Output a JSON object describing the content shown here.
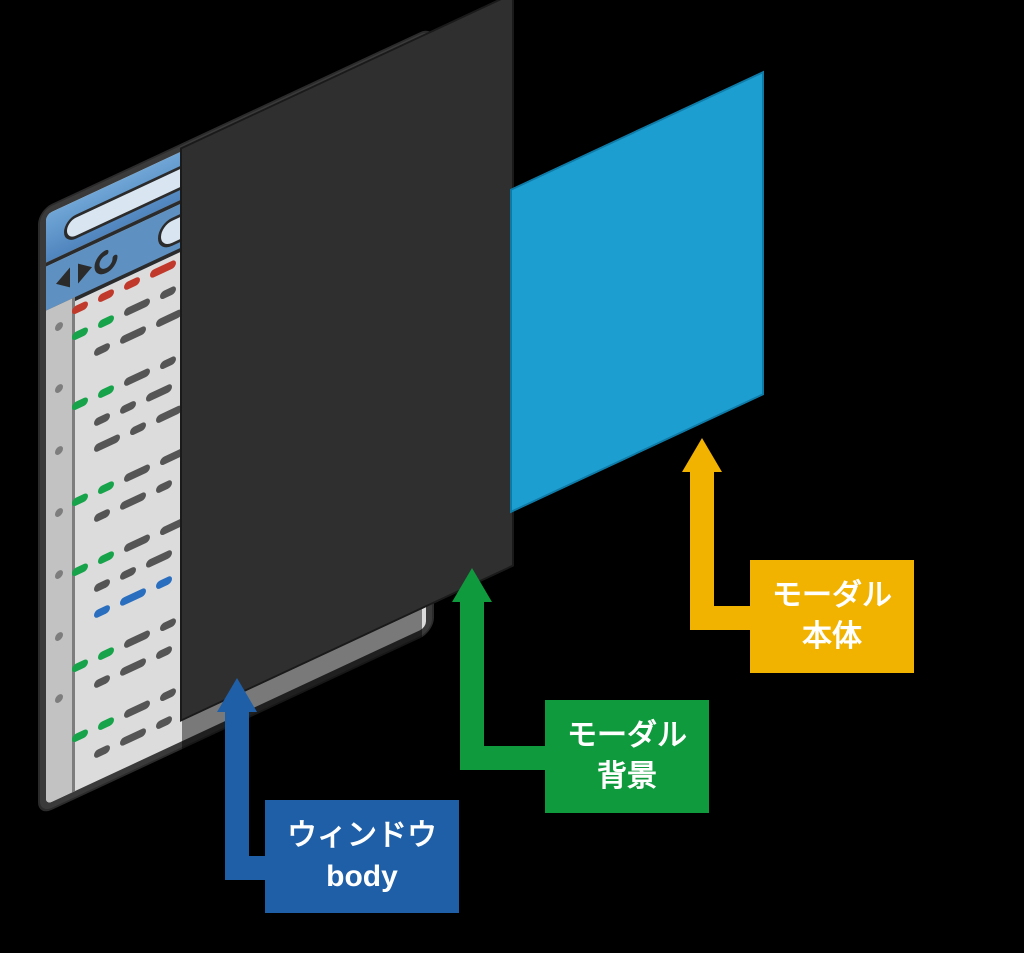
{
  "diagram": {
    "description": "Isometric illustration of three stacked browser layers: the page body, a dark modal backdrop overlay, and a blue modal dialog plane floating in front.",
    "layers": [
      {
        "id": "window-body",
        "label_lines": [
          "ウィンドウ",
          "body"
        ],
        "color": "#1f5fa8",
        "role": "base browser window / page body (back-most)"
      },
      {
        "id": "modal-backdrop",
        "label_lines": [
          "モーダル",
          "背景"
        ],
        "color": "#0e9a3d",
        "role": "semi-opaque dark overlay behind the modal"
      },
      {
        "id": "modal-body",
        "label_lines": [
          "モーダル",
          "本体"
        ],
        "color": "#f2b200",
        "role": "modal dialog element itself (front-most)"
      }
    ]
  },
  "labels": {
    "window_line1": "ウィンドウ",
    "window_line2": "body",
    "backdrop_line1": "モーダル",
    "backdrop_line2": "背景",
    "modal_line1": "モーダル",
    "modal_line2": "本体"
  },
  "colors": {
    "window_label": "#1f5fa8",
    "backdrop_label": "#0e9a3d",
    "modal_label": "#f2b200",
    "modal_plane": "#1d9ed1",
    "backdrop_plane": "#2f2f2f"
  }
}
